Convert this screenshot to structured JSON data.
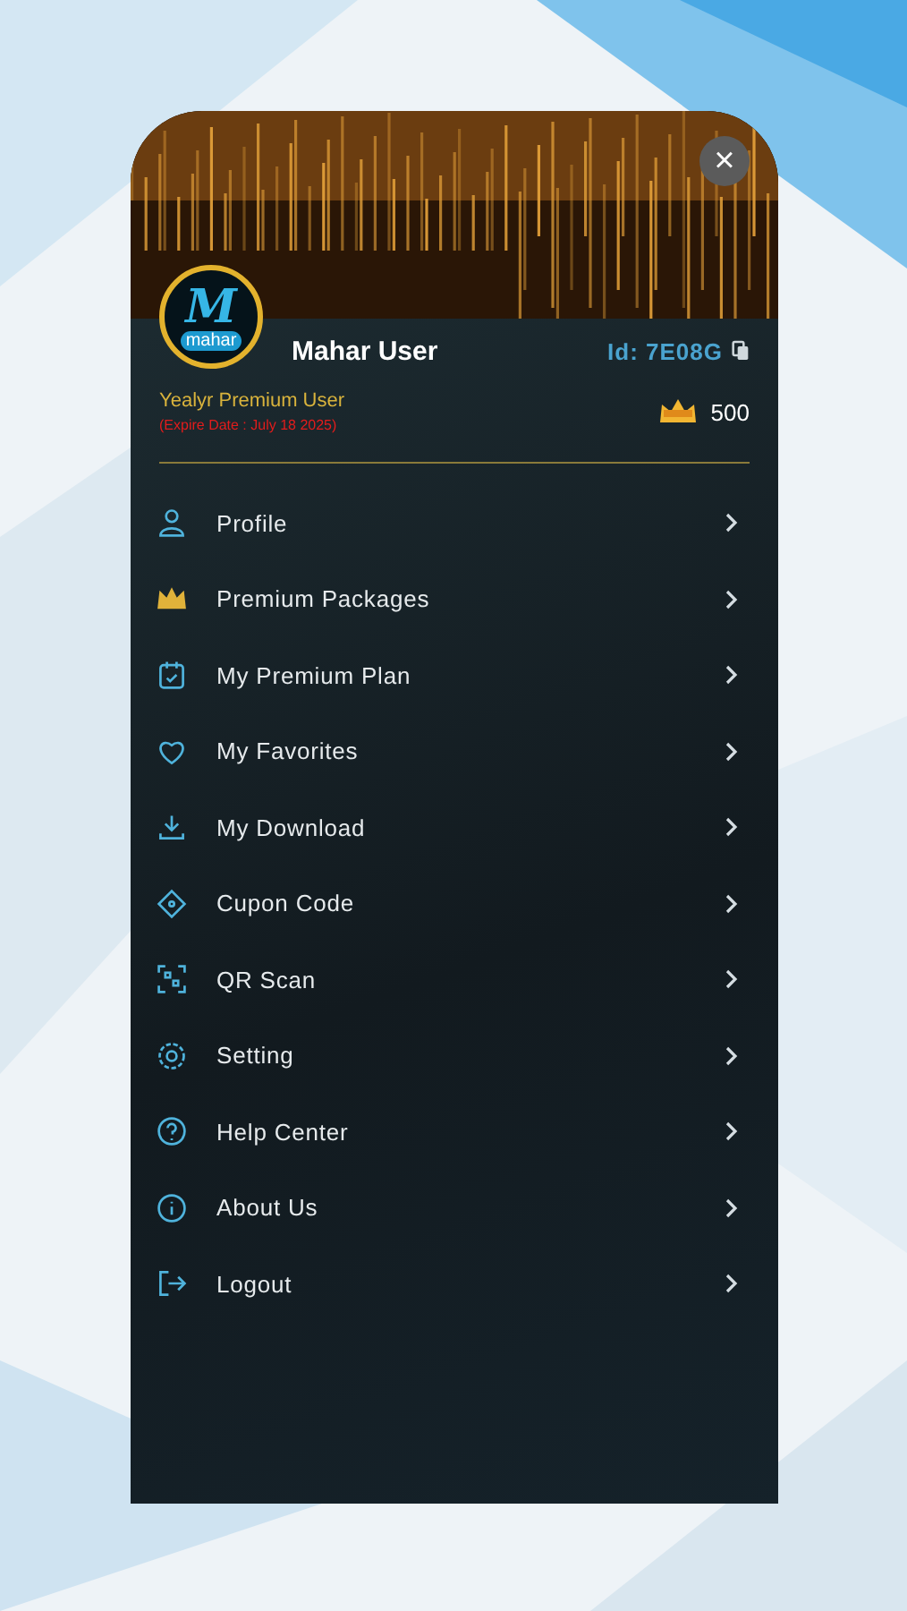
{
  "close_button": {
    "label": "×"
  },
  "logo": {
    "letter": "M",
    "word": "mahar"
  },
  "user": {
    "name": "Mahar User",
    "id": "Id: 7E08G",
    "plan": "Yealyr Premium User",
    "expiry": "(Expire Date : July 18 2025)",
    "coins": "500"
  },
  "menu": [
    {
      "label": "Profile",
      "kind": "profile"
    },
    {
      "label": "Premium Packages",
      "kind": "crown"
    },
    {
      "label": "My Premium Plan",
      "kind": "plan"
    },
    {
      "label": "My Favorites",
      "kind": "heart"
    },
    {
      "label": "My Download",
      "kind": "download"
    },
    {
      "label": "Cupon Code",
      "kind": "coupon"
    },
    {
      "label": "QR Scan",
      "kind": "qr"
    },
    {
      "label": "Setting",
      "kind": "gear"
    },
    {
      "label": "Help Center",
      "kind": "help"
    },
    {
      "label": "About Us",
      "kind": "info"
    },
    {
      "label": "Logout",
      "kind": "logout"
    }
  ]
}
